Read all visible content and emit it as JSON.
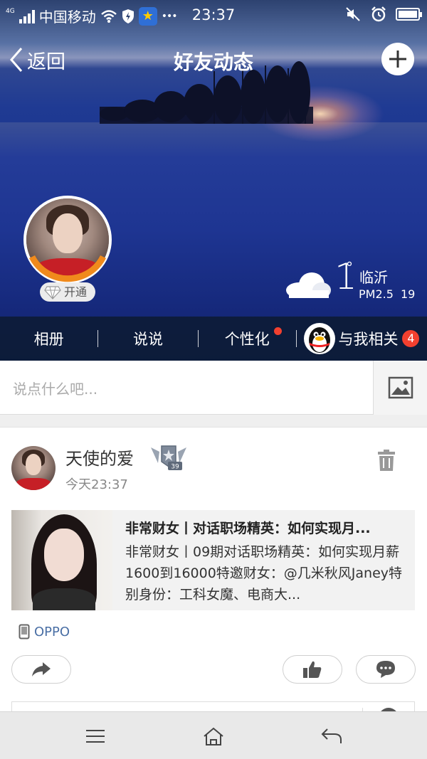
{
  "status_bar": {
    "network_type": "4G",
    "carrier": "中国移动",
    "time": "23:37",
    "more": "•••"
  },
  "nav": {
    "back_label": "返回",
    "title": "好友动态"
  },
  "profile": {
    "open_badge": "开通"
  },
  "weather": {
    "temperature": "1",
    "degree_symbol": "°",
    "city": "临沂",
    "pm_label": "PM2.5",
    "pm_value": "19"
  },
  "tabs": [
    {
      "label": "相册"
    },
    {
      "label": "说说"
    },
    {
      "label": "个性化",
      "has_dot": true
    },
    {
      "label": "与我相关",
      "badge": "4"
    }
  ],
  "composer": {
    "placeholder": "说点什么吧..."
  },
  "post": {
    "author": "天使的爱",
    "vip_level": "39",
    "time": "今天23:37",
    "share": {
      "title": "非常财女丨对话职场精英：如何实现月...",
      "description": "非常财女丨09期对话职场精英：如何实现月薪1600到16000特邀财女：@几米秋风Janey特别身份：工科女魔、电商大..."
    },
    "device": "OPPO"
  },
  "colors": {
    "accent_red": "#f2402f",
    "link_blue": "#4a6fa5",
    "tab_bg": "#0d1b34"
  }
}
